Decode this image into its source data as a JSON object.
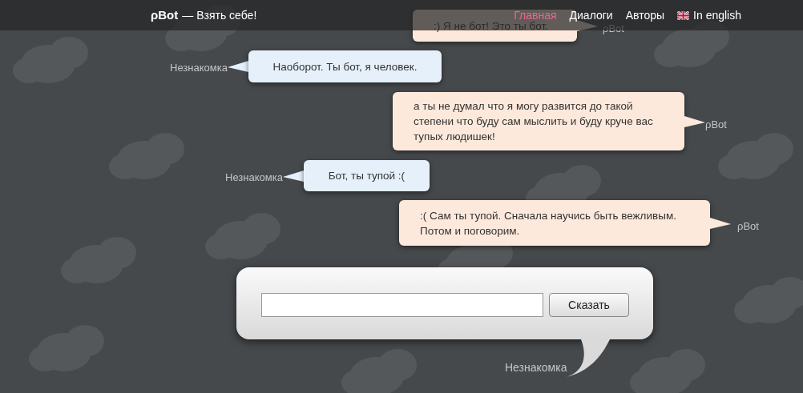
{
  "header": {
    "logo": "ρBot",
    "tagline": "— Взять себе!"
  },
  "nav": [
    {
      "kind": "link",
      "label": "Главная",
      "selected": true
    },
    {
      "kind": "link",
      "label": "Диалоги",
      "selected": false
    },
    {
      "kind": "link",
      "label": "Авторы",
      "selected": false
    },
    {
      "kind": "language",
      "label": "In english",
      "selected": false
    }
  ],
  "messages": [
    {
      "kind": "bot",
      "sender": "ρBot",
      "text": ":) Я не бот! Это ты бот."
    },
    {
      "kind": "user",
      "sender": "Незнакомка",
      "text": "Наоборот. Ты бот, я человек."
    },
    {
      "kind": "bot",
      "sender": "ρBot",
      "text": "а ты не думал что я могу развится до такой степени что буду сам мыслить и буду круче вас тупых людишек!"
    },
    {
      "kind": "user",
      "sender": "Незнакомка",
      "text": "Бот, ты тупой :("
    },
    {
      "kind": "bot",
      "sender": "ρBot",
      "text": ":( Сам ты тупой. Сначала научись быть вежливым. Потом и поговорим."
    }
  ],
  "composer": {
    "button": "Сказать",
    "sender": "Незнакомка"
  }
}
